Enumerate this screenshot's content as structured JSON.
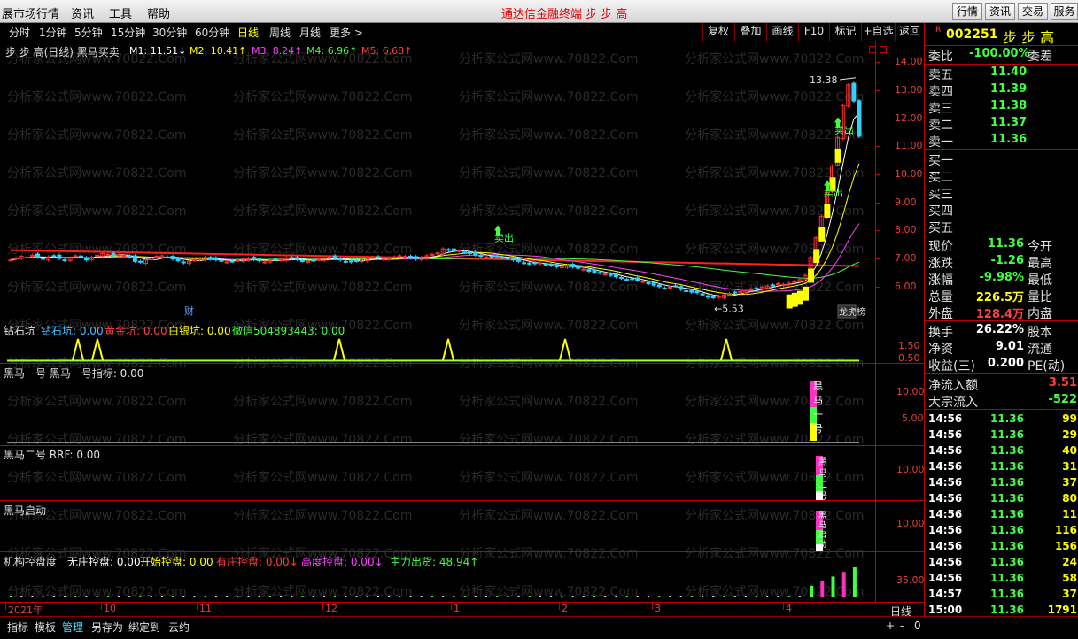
{
  "topbar": {
    "menus": [
      "展市场行情",
      "资讯",
      "工具",
      "帮助"
    ],
    "title": "通达信金融终端   步 步 高",
    "buttons": [
      "行情",
      "资讯",
      "交易",
      "服务"
    ]
  },
  "periods": [
    "分时",
    "1分钟",
    "5分钟",
    "15分钟",
    "30分钟",
    "60分钟",
    "日线",
    "周线",
    "月线",
    "更多 >"
  ],
  "active_period": "日线",
  "tools": [
    "复权",
    "叠加",
    "画线",
    "F10",
    "标记",
    "+自选",
    "返回"
  ],
  "main_panel": {
    "title": "步 步 高(日线) 黑马买卖",
    "ma": [
      {
        "label": "M1: 11.51",
        "arrow": "↓",
        "color": "#ffffff"
      },
      {
        "label": "M2: 10.41",
        "arrow": "↑",
        "color": "#ffff00"
      },
      {
        "label": "M3: 8.24",
        "arrow": "↑",
        "color": "#ff40ff"
      },
      {
        "label": "M4: 6.96",
        "arrow": "↑",
        "color": "#40ff40"
      },
      {
        "label": "M5: 6.68",
        "arrow": "↑",
        "color": "#ff4040"
      }
    ],
    "price_axis": [
      "14.00",
      "13.00",
      "12.00",
      "11.00",
      "10.00",
      "9.00",
      "8.00",
      "7.00",
      "6.00"
    ],
    "high_label": "13.38",
    "low_label": "←5.53",
    "sell_labels": [
      "卖出",
      "卖出",
      "卖出"
    ],
    "badges": [
      "财",
      "龙虎榜"
    ]
  },
  "panel2": {
    "title": "钻石坑",
    "items": [
      {
        "label": "钻石坑: 0.00",
        "color": "#40c0ff"
      },
      {
        "label": "黄金坑: 0.00",
        "color": "#ff4040"
      },
      {
        "label": "白银坑: 0.00",
        "color": "#ffff00"
      },
      {
        "label": "微信504893443: 0.00",
        "color": "#40ff40"
      }
    ],
    "axis": [
      "1.50",
      "0.50"
    ]
  },
  "panel3": {
    "title": "黑马一号  黑马一号指标: 0.00",
    "axis": [
      "10.00",
      "5.00"
    ],
    "bar_text": "黑马一号"
  },
  "panel4": {
    "title": "黑马二号  RRF: 0.00",
    "axis": [
      "10.00"
    ],
    "bar_text": "黑马二号"
  },
  "panel5": {
    "title": "黑马启动",
    "axis": [
      "10.00"
    ],
    "bar_text": "黑马启动"
  },
  "panel6": {
    "title": "机构控盘度",
    "items": [
      {
        "label": "无庄控盘: 0.00",
        "color": "#ffffff",
        "arrow": ""
      },
      {
        "label": "开始控盘: 0.00",
        "color": "#ffff00",
        "arrow": ""
      },
      {
        "label": "有庄控盘: 0.00",
        "color": "#ff4040",
        "arrow": "↓"
      },
      {
        "label": "高度控盘: 0.00",
        "color": "#ff40ff",
        "arrow": "↓"
      },
      {
        "label": "主力出货: 48.94",
        "color": "#40ff40",
        "arrow": "↑"
      }
    ],
    "axis": [
      "35.00"
    ]
  },
  "xaxis": [
    "2021年",
    "10",
    "11",
    "12",
    "1",
    "2",
    "3",
    "4"
  ],
  "x_corner": "日线",
  "watermark": [
    "分析家公式网www.70822.Com"
  ],
  "quote": {
    "code": "002251",
    "name": "步 步 高",
    "weibi": {
      "label": "委比",
      "value": "-100.00%",
      "label2": "委差"
    },
    "sells": [
      {
        "label": "卖五",
        "price": "11.40"
      },
      {
        "label": "卖四",
        "price": "11.39"
      },
      {
        "label": "卖三",
        "price": "11.38"
      },
      {
        "label": "卖二",
        "price": "11.37"
      },
      {
        "label": "卖一",
        "price": "11.36"
      }
    ],
    "buys": [
      "买一",
      "买二",
      "买三",
      "买四",
      "买五"
    ],
    "stats": [
      {
        "l": "现价",
        "v": "11.36",
        "c": "#40ff40",
        "l2": "今开"
      },
      {
        "l": "涨跌",
        "v": "-1.26",
        "c": "#40ff40",
        "l2": "最高"
      },
      {
        "l": "涨幅",
        "v": "-9.98%",
        "c": "#40ff40",
        "l2": "最低"
      },
      {
        "l": "总量",
        "v": "226.5万",
        "c": "#ffff00",
        "l2": "量比"
      },
      {
        "l": "外盘",
        "v": "128.4万",
        "c": "#ff4040",
        "l2": "内盘"
      }
    ],
    "stats2": [
      {
        "l": "换手",
        "v": "26.22%",
        "c": "#ffffff",
        "l2": "股本"
      },
      {
        "l": "净资",
        "v": "9.01",
        "c": "#ffffff",
        "l2": "流通"
      },
      {
        "l": "收益(三)",
        "v": "0.200",
        "c": "#ffffff",
        "l2": "PE(动)"
      }
    ],
    "flows": [
      {
        "l": "净流入额",
        "v": "3.51",
        "c": "#ff4040"
      },
      {
        "l": "大宗流入",
        "v": "-522",
        "c": "#40ff40"
      }
    ],
    "ticks": [
      {
        "t": "14:56",
        "p": "11.36",
        "v": "99"
      },
      {
        "t": "14:56",
        "p": "11.36",
        "v": "29"
      },
      {
        "t": "14:56",
        "p": "11.36",
        "v": "40"
      },
      {
        "t": "14:56",
        "p": "11.36",
        "v": "31"
      },
      {
        "t": "14:56",
        "p": "11.36",
        "v": "37"
      },
      {
        "t": "14:56",
        "p": "11.36",
        "v": "80"
      },
      {
        "t": "14:56",
        "p": "11.36",
        "v": "11"
      },
      {
        "t": "14:56",
        "p": "11.36",
        "v": "116"
      },
      {
        "t": "14:56",
        "p": "11.36",
        "v": "156"
      },
      {
        "t": "14:56",
        "p": "11.36",
        "v": "24"
      },
      {
        "t": "14:56",
        "p": "11.36",
        "v": "58"
      },
      {
        "t": "14:57",
        "p": "11.36",
        "v": "37"
      },
      {
        "t": "15:00",
        "p": "11.36",
        "v": "1791"
      }
    ]
  },
  "bottombar": [
    "指标",
    "模板",
    "管理",
    "另存为",
    "绑定到",
    "云约"
  ],
  "bottom_active": "管理",
  "bottom_controls": [
    "+",
    "-",
    "0"
  ],
  "chart_data": {
    "type": "candlestick",
    "ylim": [
      5.3,
      14.2
    ],
    "x": [
      "2021-08-09",
      "2021-08-10",
      "2021-08-11",
      "2021-08-12",
      "2021-08-13",
      "2021-08-16",
      "2021-08-17",
      "2021-08-18",
      "2021-08-19",
      "2021-08-20",
      "2021-08-23",
      "2021-08-24",
      "2021-08-25",
      "2021-08-26",
      "2021-08-27",
      "2021-08-30",
      "2021-08-31",
      "2021-09-01",
      "2021-09-02",
      "2021-09-03",
      "2021-09-06",
      "2021-09-07",
      "2021-09-08",
      "2021-09-09",
      "2021-09-10",
      "2021-09-13",
      "2021-09-14",
      "2021-09-15",
      "2021-09-16",
      "2021-09-17",
      "2021-09-22",
      "2021-09-23",
      "2021-09-24",
      "2021-09-27",
      "2021-09-28",
      "2021-09-29",
      "2021-09-30",
      "2021-10-08",
      "2021-10-11",
      "2021-10-12",
      "2021-10-13",
      "2021-10-14",
      "2021-10-15",
      "2021-10-18",
      "2021-10-19",
      "2021-10-20",
      "2021-10-21",
      "2021-10-22",
      "2021-10-25",
      "2021-10-26",
      "2021-10-27",
      "2021-10-28",
      "2021-10-29",
      "2021-11-01",
      "2021-11-02",
      "2021-11-03",
      "2021-11-04",
      "2021-11-05",
      "2021-11-08",
      "2021-11-09",
      "2021-11-10",
      "2021-11-11",
      "2021-11-12",
      "2021-11-15",
      "2021-11-16",
      "2021-11-17",
      "2021-11-18",
      "2021-11-19",
      "2021-11-22",
      "2021-11-23",
      "2021-11-24",
      "2021-11-25",
      "2021-11-26",
      "2021-11-29",
      "2021-11-30",
      "2021-12-01",
      "2021-12-02",
      "2021-12-03",
      "2021-12-06",
      "2021-12-07",
      "2021-12-08",
      "2021-12-09",
      "2021-12-10",
      "2021-12-13",
      "2021-12-14",
      "2021-12-15",
      "2021-12-16",
      "2021-12-17",
      "2021-12-20",
      "2021-12-21",
      "2021-12-22",
      "2021-12-23",
      "2021-12-24",
      "2021-12-27",
      "2021-12-28",
      "2021-12-29",
      "2021-12-30",
      "2021-12-31",
      "2022-01-04",
      "2022-01-05",
      "2022-01-06",
      "2022-01-07",
      "2022-01-10",
      "2022-01-11",
      "2022-01-12",
      "2022-01-13",
      "2022-01-14",
      "2022-01-17",
      "2022-01-18",
      "2022-01-19",
      "2022-01-20",
      "2022-01-21",
      "2022-01-24",
      "2022-01-25",
      "2022-01-26",
      "2022-01-27",
      "2022-01-28",
      "2022-02-07",
      "2022-02-08",
      "2022-02-09",
      "2022-02-10",
      "2022-02-11",
      "2022-02-14",
      "2022-02-15",
      "2022-02-16",
      "2022-02-17",
      "2022-02-18",
      "2022-02-21",
      "2022-02-22",
      "2022-02-23",
      "2022-02-24",
      "2022-02-25",
      "2022-02-28",
      "2022-03-01",
      "2022-03-02",
      "2022-03-03",
      "2022-03-04",
      "2022-03-07",
      "2022-03-08",
      "2022-03-09",
      "2022-03-10",
      "2022-03-11",
      "2022-03-14",
      "2022-03-15",
      "2022-03-16",
      "2022-03-17",
      "2022-03-18",
      "2022-03-21",
      "2022-03-22",
      "2022-03-23",
      "2022-03-24",
      "2022-03-25",
      "2022-03-28",
      "2022-03-29",
      "2022-03-30",
      "2022-03-31",
      "2022-04-01",
      "2022-04-06",
      "2022-04-07",
      "2022-04-08",
      "2022-04-11",
      "2022-04-12",
      "2022-04-13",
      "2022-04-14",
      "2022-04-15",
      "2022-04-18"
    ],
    "close": [
      6.95,
      7.02,
      7.08,
      7.05,
      7.12,
      7.04,
      6.98,
      7.06,
      7.1,
      7.0,
      6.94,
      7.02,
      7.1,
      7.08,
      6.95,
      7.05,
      7.12,
      7.18,
      7.15,
      7.1,
      7.14,
      7.12,
      7.05,
      6.9,
      6.88,
      6.95,
      7.02,
      7.08,
      7.1,
      7.05,
      6.98,
      6.92,
      6.85,
      6.9,
      6.95,
      7.0,
      7.04,
      6.98,
      6.95,
      6.92,
      6.88,
      6.9,
      6.94,
      6.98,
      7.0,
      6.96,
      6.92,
      6.88,
      6.92,
      6.95,
      6.98,
      7.02,
      7.0,
      6.96,
      6.92,
      6.9,
      6.94,
      6.98,
      7.02,
      7.05,
      7.0,
      6.95,
      6.9,
      6.88,
      6.92,
      6.96,
      7.0,
      7.04,
      7.02,
      6.98,
      7.0,
      7.06,
      7.1,
      7.08,
      7.02,
      6.98,
      7.04,
      7.1,
      7.15,
      7.2,
      7.35,
      7.3,
      7.26,
      7.28,
      7.22,
      7.18,
      7.12,
      7.1,
      7.06,
      7.05,
      7.08,
      7.04,
      7.0,
      6.95,
      6.9,
      6.85,
      6.8,
      6.82,
      6.85,
      6.78,
      6.75,
      6.7,
      6.72,
      6.76,
      6.7,
      6.65,
      6.62,
      6.55,
      6.5,
      6.48,
      6.45,
      6.4,
      6.35,
      6.3,
      6.25,
      6.28,
      6.22,
      6.18,
      6.1,
      6.05,
      6.0,
      5.95,
      5.98,
      6.02,
      5.9,
      5.85,
      5.8,
      5.78,
      5.7,
      5.62,
      5.6,
      5.65,
      5.7,
      5.75,
      5.78,
      5.82,
      5.86,
      5.9,
      5.94,
      5.98,
      6.02,
      6.06,
      6.1,
      6.08,
      6.12,
      6.18,
      6.25,
      6.4,
      7.04,
      7.74,
      8.51,
      9.36,
      10.3,
      11.32,
      12.45,
      13.2,
      12.62,
      11.36
    ]
  }
}
